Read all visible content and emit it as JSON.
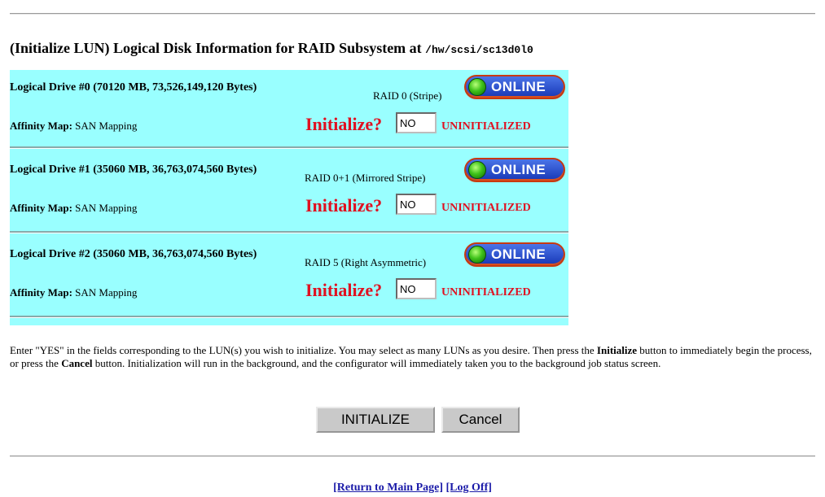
{
  "title": {
    "text": "(Initialize LUN) Logical Disk Information for RAID Subsystem at ",
    "path": "/hw/scsi/sc13d0l0"
  },
  "drives": [
    {
      "title": "Logical Drive #0 (70120 MB, 73,526,149,120 Bytes)",
      "raid": "RAID 0 (Stripe)",
      "state": "ONLINE",
      "affinity_label": "Affinity Map:",
      "affinity_value": "SAN Mapping",
      "init_label": "Initialize?",
      "init_value": "NO",
      "status": "UNINITIALIZED"
    },
    {
      "title": "Logical Drive #1 (35060 MB, 36,763,074,560 Bytes)",
      "raid": "RAID 0+1 (Mirrored Stripe)",
      "state": "ONLINE",
      "affinity_label": "Affinity Map:",
      "affinity_value": "SAN Mapping",
      "init_label": "Initialize?",
      "init_value": "NO",
      "status": "UNINITIALIZED"
    },
    {
      "title": "Logical Drive #2 (35060 MB, 36,763,074,560 Bytes)",
      "raid": "RAID 5 (Right Asymmetric)",
      "state": "ONLINE",
      "affinity_label": "Affinity Map:",
      "affinity_value": "SAN Mapping",
      "init_label": "Initialize?",
      "init_value": "NO",
      "status": "UNINITIALIZED"
    }
  ],
  "instructions": {
    "part1": "Enter \"YES\" in the fields corresponding to the LUN(s) you wish to initialize. You may select as many LUNs as you desire. Then press the ",
    "bold1": "Initialize",
    "part2": " button to immediately begin the process, or press the ",
    "bold2": "Cancel",
    "part3": " button. Initialization will run in the background, and the configurator will immediately taken you to the background job status screen."
  },
  "buttons": {
    "initialize": "INITIALIZE",
    "cancel": "Cancel"
  },
  "links": {
    "main": "[Return to Main Page]",
    "logoff": "[Log Off]"
  },
  "colors": {
    "table_bg": "#99ffff",
    "alert_red": "#e01020",
    "link_blue": "#1a1aa8",
    "online_badge": "#2a4fd0",
    "online_led": "#3fc21a"
  }
}
